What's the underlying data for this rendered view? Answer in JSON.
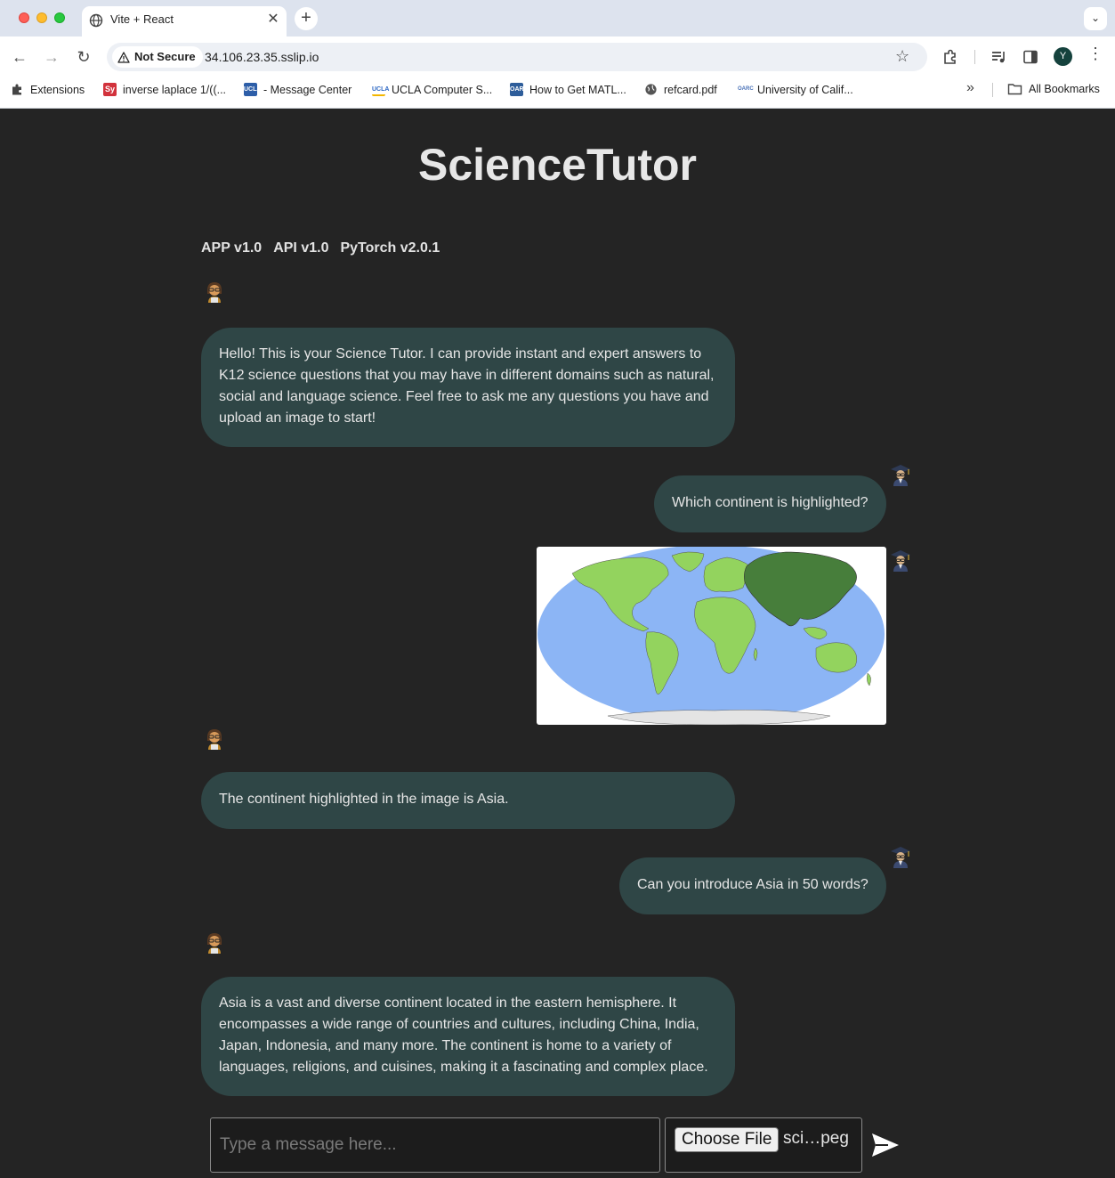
{
  "browser": {
    "tab_title": "Vite + React",
    "security_label": "Not Secure",
    "url": "34.106.23.35.sslip.io",
    "profile_initial": "Y",
    "bookmarks": [
      {
        "label": "Extensions",
        "favicon": "puzzle-icon"
      },
      {
        "label": "inverse laplace 1/((...",
        "favicon": "Sy"
      },
      {
        "label": "- Message Center",
        "favicon": "UCLA"
      },
      {
        "label": "UCLA Computer S...",
        "favicon": "UCLA"
      },
      {
        "label": "How to Get MATL...",
        "favicon": "OARC"
      },
      {
        "label": "refcard.pdf",
        "favicon": "globe-icon"
      },
      {
        "label": "University of Calif...",
        "favicon": "OARC"
      }
    ],
    "all_bookmarks": "All Bookmarks"
  },
  "app": {
    "title": "ScienceTutor",
    "versions": [
      "APP v1.0",
      "API v1.0",
      "PyTorch v2.0.1"
    ]
  },
  "messages": [
    {
      "role": "bot",
      "avatar": "student-emoji",
      "text": "Hello! This is your Science Tutor. I can provide instant and expert answers to K12 science questions that you may have in different domains such as natural, social and language science. Feel free to ask me any questions you have and upload an image to start!"
    },
    {
      "role": "user",
      "avatar": "graduate-emoji",
      "text": "Which continent is highlighted?"
    },
    {
      "role": "user",
      "avatar": "graduate-emoji",
      "image": "world-map-asia-highlighted"
    },
    {
      "role": "bot",
      "avatar": "student-emoji",
      "text": "The continent highlighted in the image is Asia."
    },
    {
      "role": "user",
      "avatar": "graduate-emoji",
      "text": "Can you introduce Asia in 50 words?"
    },
    {
      "role": "bot",
      "avatar": "student-emoji",
      "text": "Asia is a vast and diverse continent located in the eastern hemisphere. It encompasses a wide range of countries and cultures, including China, India, Japan, Indonesia, and many more. The continent is home to a variety of languages, religions, and cuisines, making it a fascinating and complex place."
    }
  ],
  "composer": {
    "placeholder": "Type a message here...",
    "choose_file_label": "Choose File",
    "file_name": "sci…peg"
  },
  "colors": {
    "page_bg": "#242424",
    "bubble_bg": "#2f4646",
    "ocean": "#8cb5f5",
    "land": "#93d35e",
    "highlighted_land": "#477e3b"
  }
}
